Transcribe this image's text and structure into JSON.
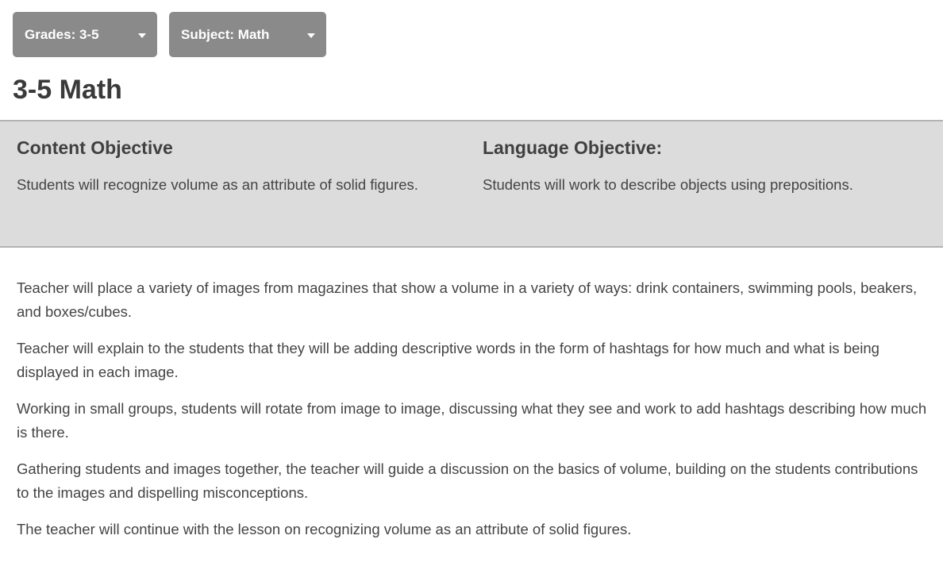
{
  "filters": {
    "grades_label": "Grades: 3-5",
    "subject_label": "Subject: Math"
  },
  "page": {
    "title": "3-5 Math"
  },
  "objectives": {
    "content": {
      "heading": "Content Objective",
      "text": "Students will recognize volume as an attribute of solid figures."
    },
    "language": {
      "heading": "Language Objective:",
      "text": "Students will work to describe objects using prepositions."
    }
  },
  "steps": [
    "Teacher will place a variety of images from magazines that show a volume in a variety of ways: drink containers, swimming pools, beakers, and boxes/cubes.",
    "Teacher will explain to the students that they will be adding descriptive words in the form of hashtags for how much and what is being displayed in each image.",
    "Working in small groups, students will rotate from image to image, discussing what they see and work to add hashtags describing how much is there.",
    "Gathering students and images together, the teacher will guide a discussion on the basics of volume, building on the students contributions to the images and dispelling misconceptions.",
    "The teacher will continue with the lesson on recognizing volume as an attribute of solid figures."
  ],
  "colors": {
    "filter_button_bg": "#8a8a8a",
    "objectives_bg": "#dcdcdc",
    "text": "#444444"
  },
  "icons": {
    "dropdown": "caret-down-icon"
  }
}
